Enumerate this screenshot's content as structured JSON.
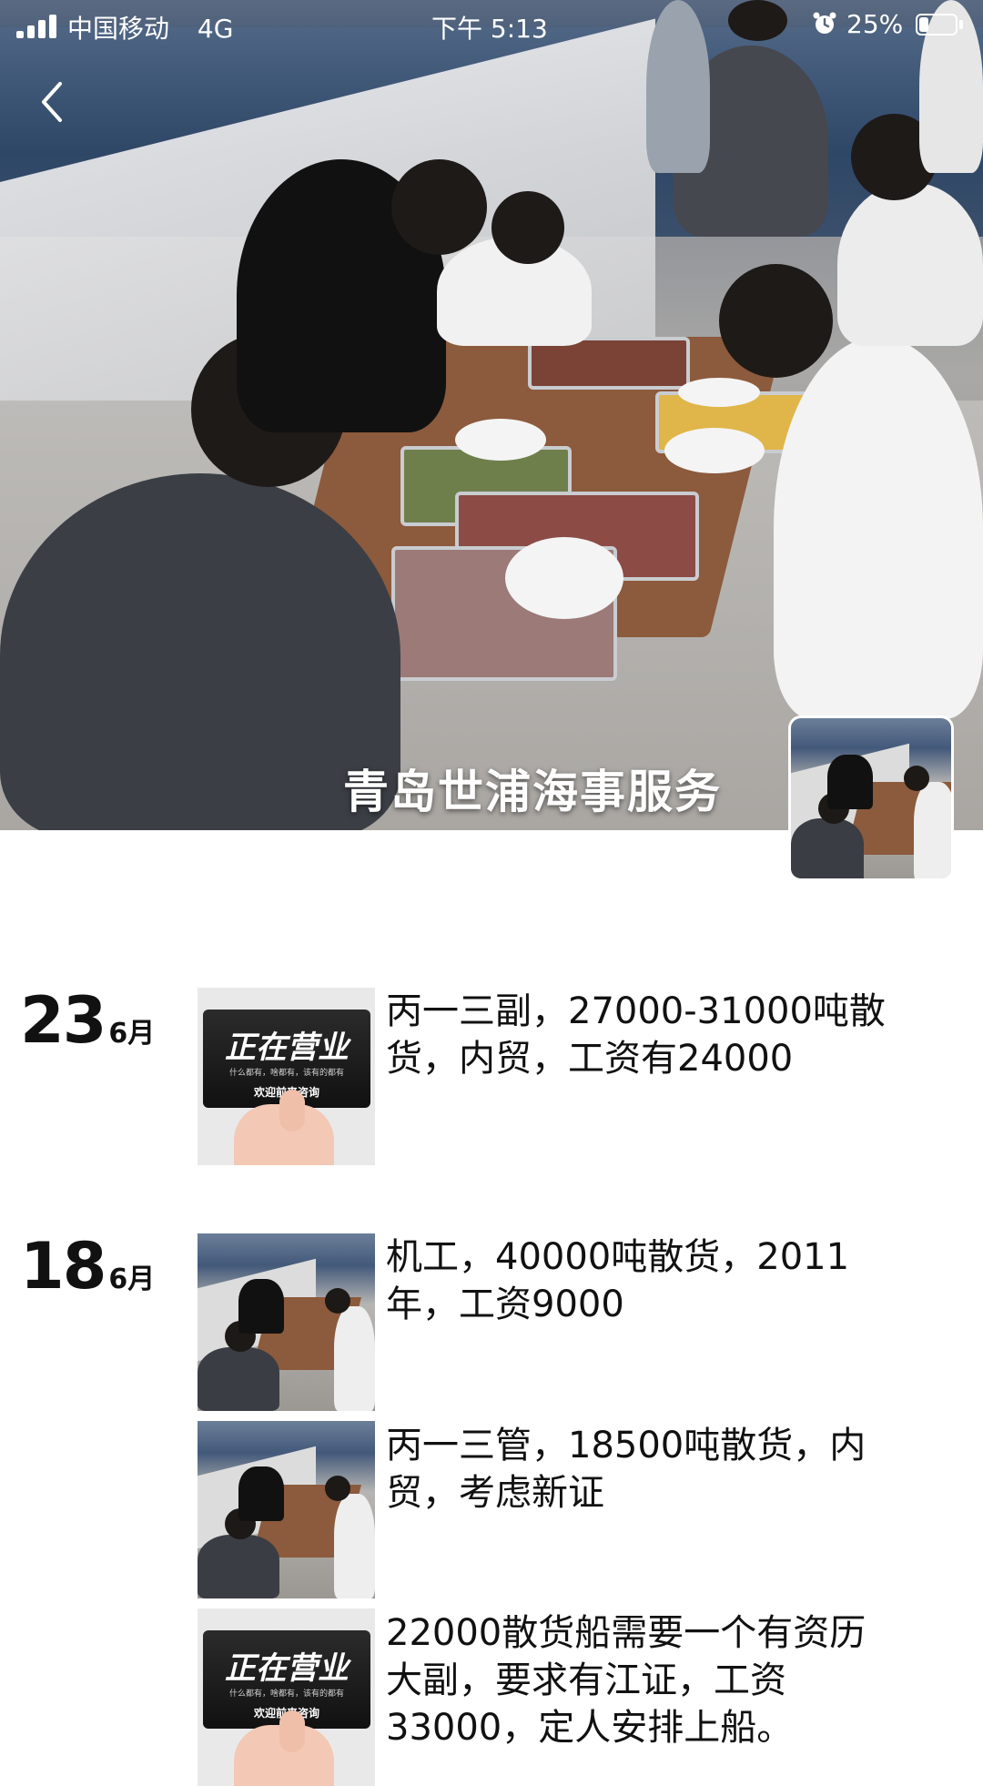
{
  "status_bar": {
    "carrier": "中国移动",
    "network": "4G",
    "time": "下午 5:13",
    "battery": "25%",
    "battery_level": 0.25,
    "icons": [
      "signal-icon",
      "alarm-icon",
      "battery-icon"
    ]
  },
  "header": {
    "back_icon": "chevron-left-icon",
    "cover_title": "青岛世浦海事服务"
  },
  "timeline": [
    {
      "day": "23",
      "month": "6月",
      "posts": [
        {
          "thumbnail": "open-for-business-card",
          "thumb_text": {
            "title": "正在营业",
            "sub": "什么都有，啥都有，该有的都有",
            "foot": "欢迎前来咨询"
          },
          "text": "丙一三副，27000-31000吨散货，内贸，工资有24000"
        }
      ]
    },
    {
      "day": "18",
      "month": "6月",
      "posts": [
        {
          "thumbnail": "deck-barbecue-photo",
          "text": "机工，40000吨散货，2011年，工资9000"
        },
        {
          "thumbnail": "deck-barbecue-photo",
          "text": "丙一三管，18500吨散货，内贸，考虑新证"
        },
        {
          "thumbnail": "open-for-business-card",
          "thumb_text": {
            "title": "正在营业",
            "sub": "什么都有，啥都有，该有的都有",
            "foot": "欢迎前来咨询"
          },
          "text": "22000散货船需要一个有资历大副，要求有江证，工资33000，定人安排上船。"
        }
      ]
    }
  ]
}
